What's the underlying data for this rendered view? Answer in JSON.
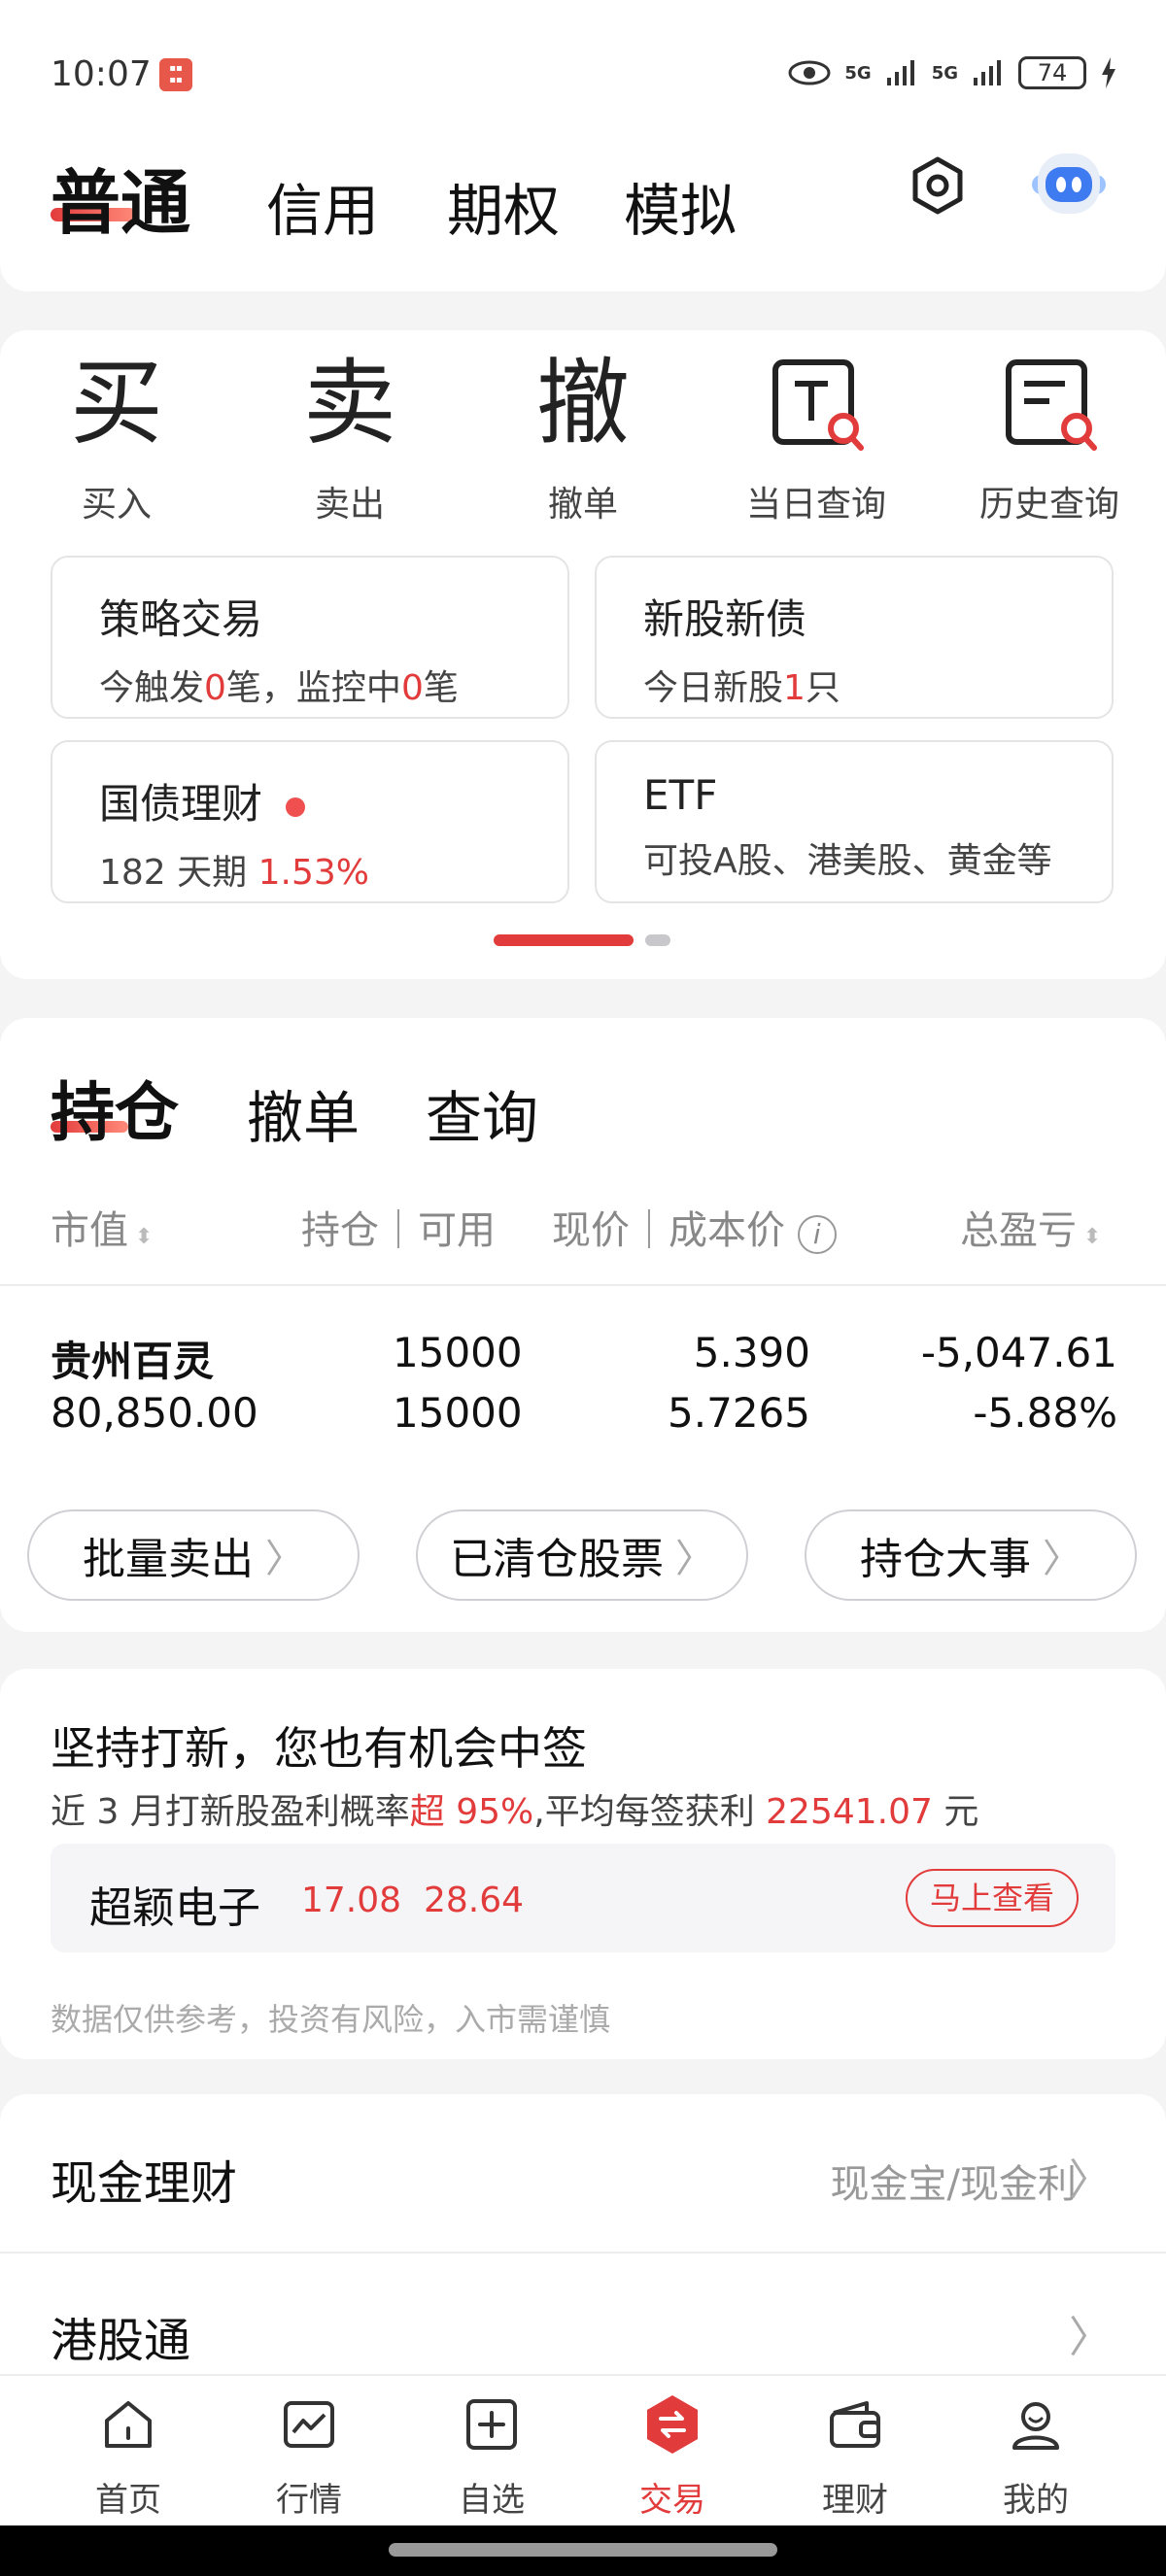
{
  "status_bar": {
    "time": "10:07",
    "signal_1": "5G",
    "signal_2": "5G",
    "battery": "74"
  },
  "header": {
    "tabs": [
      "普通",
      "信用",
      "期权",
      "模拟"
    ]
  },
  "quick_actions": [
    {
      "glyph": "买",
      "label": "买入"
    },
    {
      "glyph": "卖",
      "label": "卖出"
    },
    {
      "glyph": "撤",
      "label": "撤单"
    },
    {
      "label": "当日查询"
    },
    {
      "label": "历史查询"
    }
  ],
  "features": {
    "strategy": {
      "title": "策略交易",
      "sub_a": "今触发",
      "count_a": "0",
      "sub_b": "笔，监控中",
      "count_b": "0",
      "sub_c": "笔"
    },
    "ipo": {
      "title": "新股新债",
      "sub_a": "今日新股",
      "count": "1",
      "sub_b": "只"
    },
    "bond": {
      "title": "国债理财",
      "sub_a": "182 天期 ",
      "rate": "1.53%"
    },
    "etf": {
      "title": "ETF",
      "sub": "可投A股、港美股、黄金等"
    }
  },
  "positions": {
    "tabs": [
      "持仓",
      "撤单",
      "查询"
    ],
    "headers": {
      "market_value": "市值",
      "holdings": "持仓｜可用",
      "price": "现价｜成本价",
      "pnl": "总盈亏"
    },
    "rows": [
      {
        "name": "贵州百灵",
        "market_value": "80,850.00",
        "holding": "15000",
        "available": "15000",
        "price": "5.390",
        "cost": "5.7265",
        "pnl": "-5,047.61",
        "pnl_pct": "-5.88%"
      }
    ],
    "buttons": [
      "批量卖出",
      "已清仓股票",
      "持仓大事"
    ]
  },
  "ipo_promo": {
    "title": "坚持打新，您也有机会中签",
    "sub_a": "近 3 月打新股盈利概率",
    "sub_b": "超 95%",
    "sub_c": ",平均每签获利 ",
    "sub_d": "22541.07",
    "sub_e": " 元",
    "stock_name": "超颖电子",
    "price_a": "17.08",
    "price_b": "28.64",
    "button": "马上查看",
    "disclaimer": "数据仅供参考，投资有风险，入市需谨慎"
  },
  "list_rows": [
    {
      "title": "现金理财",
      "right": "现金宝/现金利"
    },
    {
      "title": "港股通",
      "right": ""
    }
  ],
  "bottom_nav": [
    {
      "label": "首页",
      "icon": "home-icon"
    },
    {
      "label": "行情",
      "icon": "chart-icon"
    },
    {
      "label": "自选",
      "icon": "add-watchlist-icon"
    },
    {
      "label": "交易",
      "icon": "trade-icon"
    },
    {
      "label": "理财",
      "icon": "wallet-icon"
    },
    {
      "label": "我的",
      "icon": "profile-icon"
    }
  ],
  "colors": {
    "accent": "#e23b3b",
    "gain_down": "#0ca46b"
  }
}
